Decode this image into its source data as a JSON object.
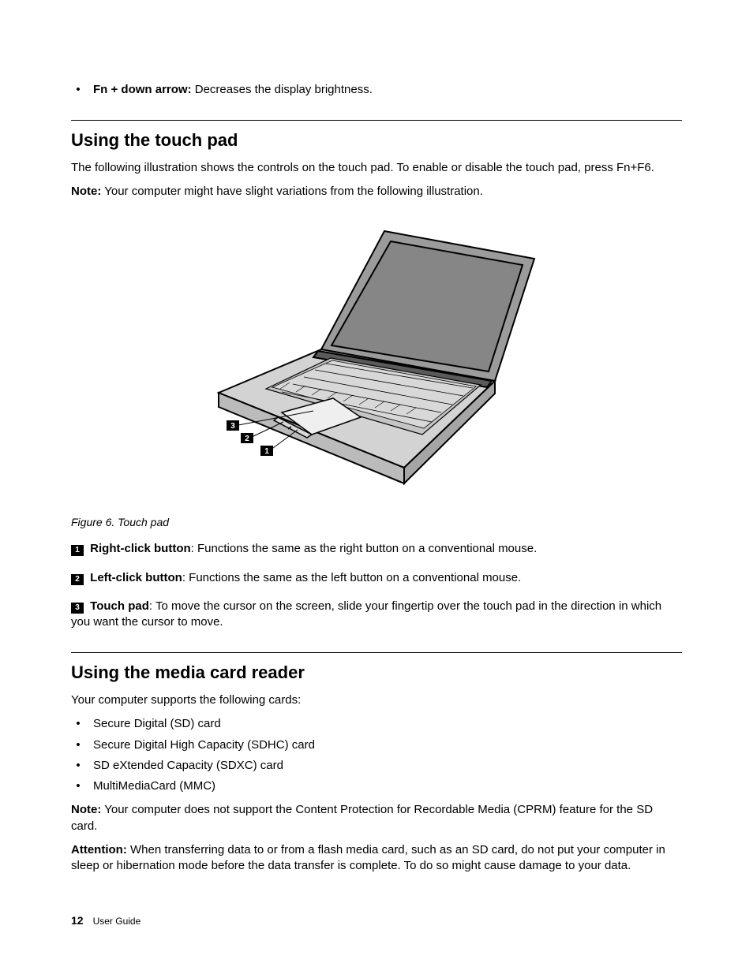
{
  "top_bullet": {
    "label": "Fn + down arrow:",
    "desc": " Decreases the display brightness."
  },
  "section1": {
    "title": "Using the touch pad",
    "intro": "The following illustration shows the controls on the touch pad. To enable or disable the touch pad, press Fn+F6.",
    "note_label": "Note:",
    "note_body": " Your computer might have slight variations from the following illustration.",
    "figure_caption": "Figure 6.  Touch pad",
    "legend": [
      {
        "num": "1",
        "label": " Right-click button",
        "desc": ": Functions the same as the right button on a conventional mouse."
      },
      {
        "num": "2",
        "label": " Left-click button",
        "desc": ": Functions the same as the left button on a conventional mouse."
      },
      {
        "num": "3",
        "label": " Touch pad",
        "desc": ": To move the cursor on the screen, slide your fingertip over the touch pad in the direction in which you want the cursor to move."
      }
    ],
    "callouts": {
      "c1": "1",
      "c2": "2",
      "c3": "3"
    }
  },
  "section2": {
    "title": "Using the media card reader",
    "intro": "Your computer supports the following cards:",
    "cards": [
      "Secure Digital (SD) card",
      "Secure Digital High Capacity (SDHC) card",
      "SD eXtended Capacity (SDXC) card",
      "MultiMediaCard (MMC)"
    ],
    "note_label": "Note:",
    "note_body": " Your computer does not support the Content Protection for Recordable Media (CPRM) feature for the SD card.",
    "attn_label": "Attention:",
    "attn_body": " When transferring data to or from a flash media card, such as an SD card, do not put your computer in sleep or hibernation mode before the data transfer is complete. To do so might cause damage to your data."
  },
  "footer": {
    "page_number": "12",
    "book_title": "User Guide"
  }
}
